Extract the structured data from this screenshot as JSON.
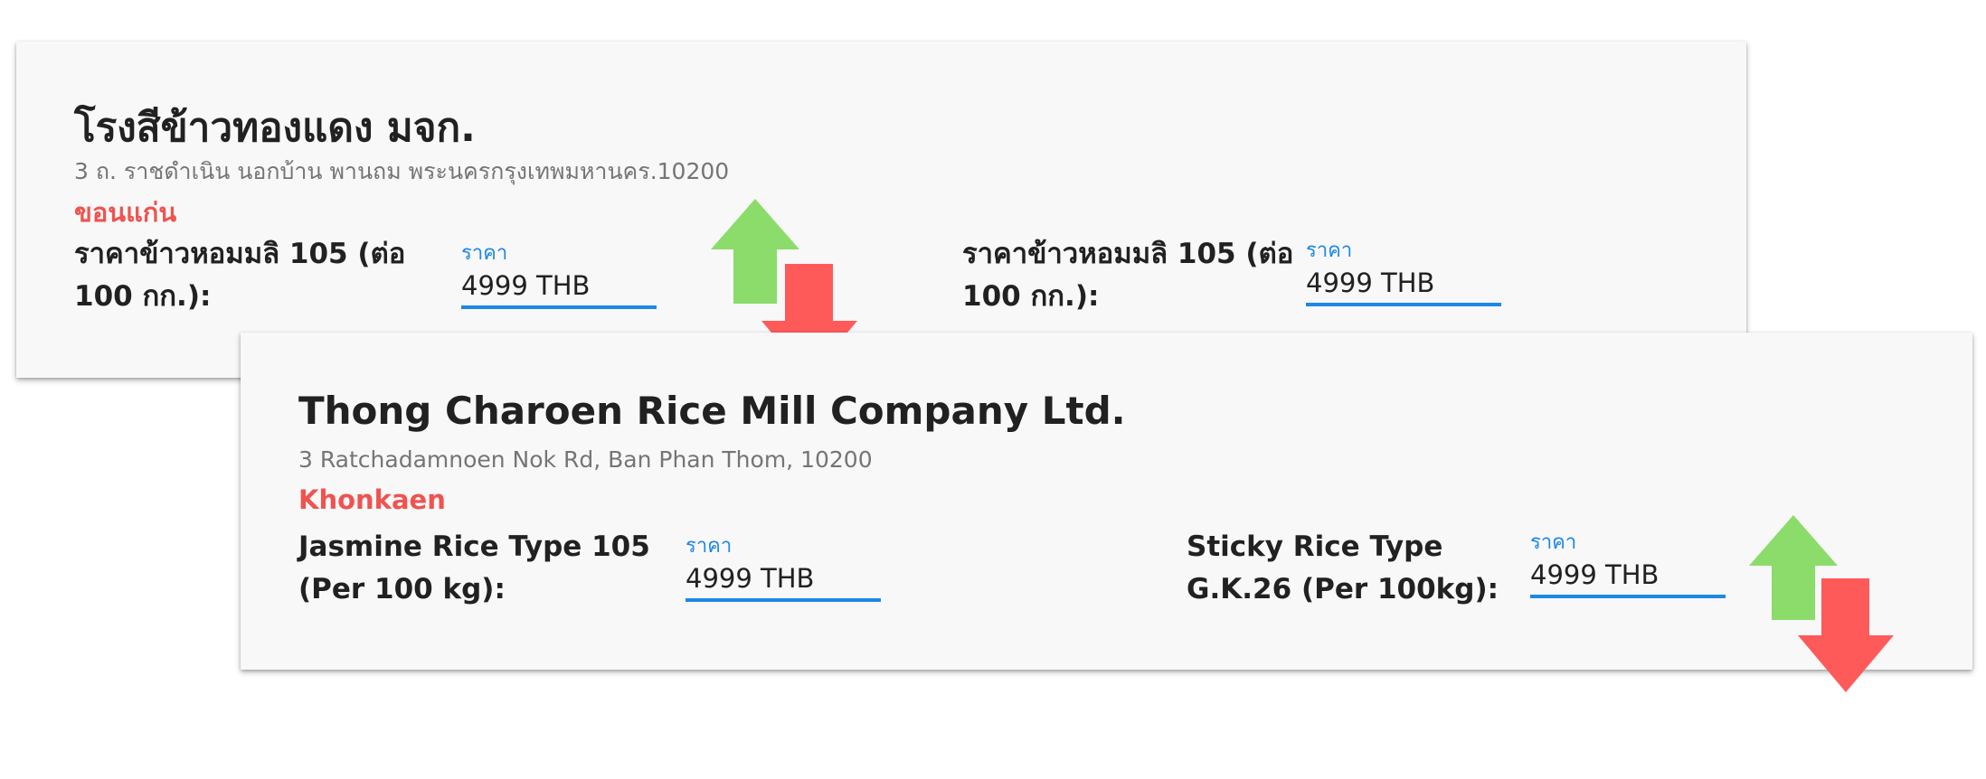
{
  "thai_card": {
    "title": "โรงสีข้าวทองแดง มจก.",
    "address": "3 ถ. ราชดำเนิน นอกบ้าน พานถม พระนครกรุงเทพมหานคร.10200",
    "province": "ขอนแก่น",
    "prices": [
      {
        "label": "ราคาข้าวหอมมลิ 105 (ต่อ 100 กก.):",
        "field_label": "ราคา",
        "value": "4999 THB"
      },
      {
        "label": "ราคาข้าวหอมมลิ 105 (ต่อ 100 กก.):",
        "field_label": "ราคา",
        "value": "4999 THB"
      }
    ],
    "trend_icons": [
      "arrow-up-icon",
      "arrow-down-icon"
    ]
  },
  "english_card": {
    "title": "Thong Charoen Rice Mill Company Ltd.",
    "address": "3 Ratchadamnoen Nok Rd, Ban Phan Thom, 10200",
    "province": "Khonkaen",
    "prices": [
      {
        "label": "Jasmine Rice Type 105 (Per 100 kg):",
        "field_label": "ราคา",
        "value": "4999 THB"
      },
      {
        "label": "Sticky Rice Type G.K.26 (Per 100kg):",
        "field_label": "ราคา",
        "value": "4999 THB"
      }
    ],
    "trend_icons": [
      "arrow-up-icon",
      "arrow-down-icon"
    ]
  },
  "colors": {
    "accent": "#1e88e5",
    "province": "#ef5350",
    "arrow_up": "#8bdc6a",
    "arrow_down": "#ff5a5a",
    "card_background": "#f8f8f8"
  }
}
